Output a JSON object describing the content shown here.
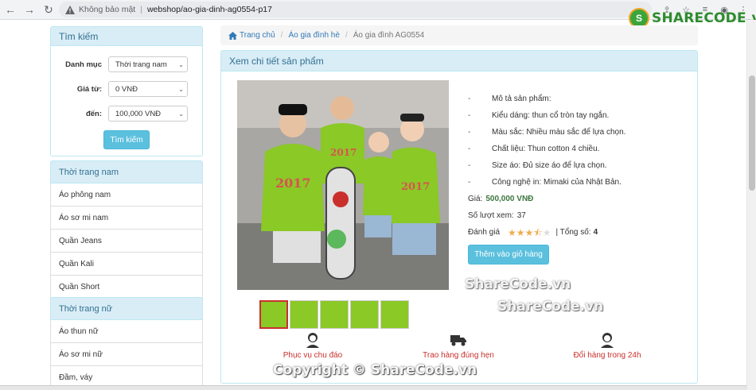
{
  "browser": {
    "security_label": "Không bảo mật",
    "url": "webshop/ao-gia-dinh-ag0554-p17",
    "watermark_logo": "SHARECODE.vn"
  },
  "search": {
    "title": "Tìm kiếm",
    "category_label": "Danh mục",
    "category_value": "Thời trang nam",
    "price_from_label": "Giá từ:",
    "price_from_value": "0 VNĐ",
    "price_to_label": "đến:",
    "price_to_value": "100,000 VNĐ",
    "button": "Tìm kiếm"
  },
  "categories": [
    {
      "title": "Thời trang nam",
      "items": [
        "Áo phông nam",
        "Áo sơ mi nam",
        "Quần Jeans",
        "Quần Kali",
        "Quần Short"
      ]
    },
    {
      "title": "Thời trang nữ",
      "items": [
        "Áo thun nữ",
        "Áo sơ mi nữ",
        "Đầm, váy"
      ]
    }
  ],
  "breadcrumb": [
    "Trang chủ",
    "Áo gia đình hè",
    "Áo gia đình AG0554"
  ],
  "detail": {
    "title": "Xem chi tiết sản phẩm",
    "image_print": "2017",
    "features": [
      "Mô tả sản phẩm:",
      "Kiểu dáng: thun cổ tròn tay ngắn.",
      "Màu sắc: Nhiều màu sắc để lựa chọn.",
      "Chất liệu: Thun cotton 4 chiều.",
      "Size áo: Đủ size áo để lựa chọn.",
      "Công nghệ in: Mimaki của Nhật Bản."
    ],
    "price_label": "Giá:",
    "price": "500,000 VNĐ",
    "views_label": "Số lượt xem:",
    "views": "37",
    "rating_label": "Đánh giá",
    "rating": 3.5,
    "rating_max": 5,
    "total_label": "| Tổng số:",
    "total": "4",
    "cart_button": "Thêm vào giỏ hàng",
    "thumbnail_count": 5
  },
  "services": [
    "Phục vụ chu đáo",
    "Trao hàng đúng hẹn",
    "Đổi hàng trong 24h"
  ],
  "watermarks": [
    "ShareCode.vn",
    "ShareCode.vn"
  ],
  "copyright": "Copyright © ShareCode.vn",
  "colors": {
    "accent": "#5bc0de",
    "panel_head": "#d9edf7",
    "price": "#3c763d",
    "service": "#c9302c"
  }
}
